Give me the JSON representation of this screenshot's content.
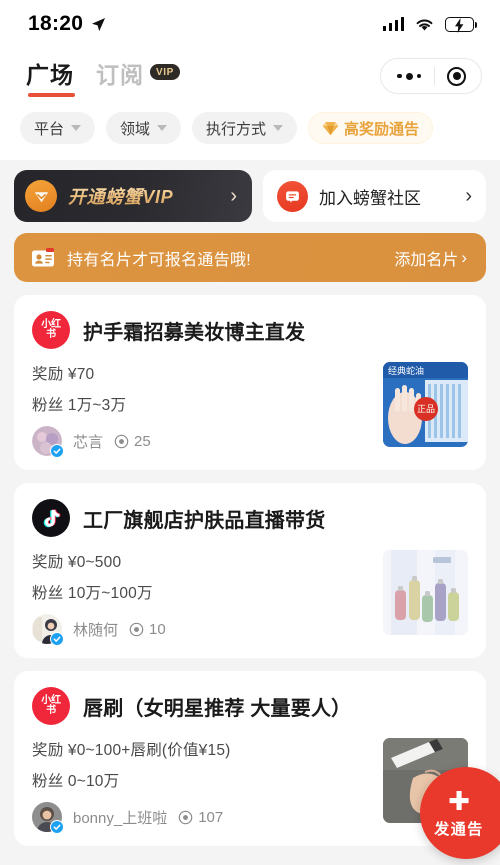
{
  "status_bar": {
    "time": "18:20",
    "location_icon": "location-arrow-icon",
    "signal_icon": "signal-bars-icon",
    "wifi_icon": "wifi-icon",
    "battery_icon": "battery-charging-icon",
    "battery_color": "#34c759"
  },
  "nav": {
    "tabs": [
      {
        "label": "广场",
        "active": true
      },
      {
        "label": "订阅",
        "active": false,
        "badge": "VIP"
      }
    ],
    "capsule": {
      "menu_icon": "more-dots-icon",
      "target_icon": "target-circle-icon"
    }
  },
  "filters": [
    {
      "label": "平台",
      "type": "dropdown"
    },
    {
      "label": "领域",
      "type": "dropdown"
    },
    {
      "label": "执行方式",
      "type": "dropdown"
    },
    {
      "label": "高奖励通告",
      "type": "highlight",
      "icon": "diamond-icon",
      "color": "#e8a33d"
    }
  ],
  "promos": {
    "vip": {
      "label": "开通螃蟹VIP",
      "icon": "vip-diamond-icon",
      "arrow": "›",
      "bg_color": "#25252a",
      "accent_color": "#e8b978"
    },
    "community": {
      "label": "加入螃蟹社区",
      "icon": "chat-bubble-icon",
      "arrow": "›",
      "icon_color": "#e63820"
    }
  },
  "notice": {
    "icon": "id-card-icon",
    "text": "持有名片才可报名通告哦!",
    "cta": "添加名片",
    "cta_arrow": "›",
    "bg_color": "#d9913f"
  },
  "jobs": [
    {
      "platform": "xiaohongshu",
      "platform_label": "小红书",
      "title": "护手霜招募美妆博主直发",
      "reward": "奖励 ¥70",
      "fans": "粉丝 1万~3万",
      "user": "芯言",
      "verified": true,
      "views": "25",
      "thumb": "hand-cream-product-image"
    },
    {
      "platform": "douyin",
      "platform_label": "抖音",
      "title": "工厂旗舰店护肤品直播带货",
      "reward": "奖励 ¥0~500",
      "fans": "粉丝 10万~100万",
      "user": "林随何",
      "verified": true,
      "views": "10",
      "thumb": "skincare-bottles-image"
    },
    {
      "platform": "xiaohongshu",
      "platform_label": "小红书",
      "title": "唇刷（女明星推荐 大量要人）",
      "reward": "奖励 ¥0~100+唇刷(价值¥15)",
      "fans": "粉丝 0~10万",
      "user": "bonny_上班啦",
      "verified": true,
      "views": "107",
      "thumb": "lip-brush-image"
    }
  ],
  "fab": {
    "plus": "✚",
    "label": "发通告",
    "color": "#e8392c"
  }
}
